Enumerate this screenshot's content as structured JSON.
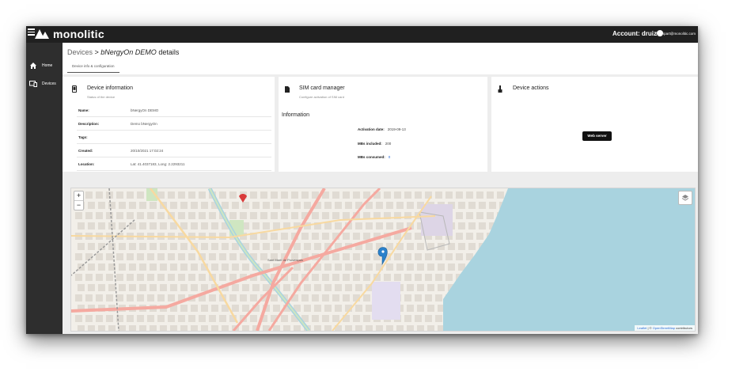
{
  "topbar": {
    "brand": "monolitic",
    "account_label": "Account: druiz",
    "email": "jmonpart@monolitic.com"
  },
  "sidebar": {
    "items": [
      {
        "label": "Home",
        "icon": "home-icon"
      },
      {
        "label": "Devices",
        "icon": "devices-icon"
      }
    ]
  },
  "breadcrumb": {
    "root": "Devices",
    "separator": " > ",
    "device": "bNergyOn DEMO",
    "suffix": " details"
  },
  "tabs": [
    {
      "label": "Device info & configuration",
      "active": true
    }
  ],
  "device_info": {
    "title": "Device information",
    "subtitle": "Status of the device",
    "rows": [
      {
        "key": "Name:",
        "value": "bNergyOn DEMO"
      },
      {
        "key": "Description:",
        "value": "Demo bNergyOn"
      },
      {
        "key": "Tags:",
        "value": ""
      },
      {
        "key": "Created:",
        "value": "20/10/2021 17:02:24"
      },
      {
        "key": "Location:",
        "value": "Lat: 41.4037183, Long: 2.2293211"
      }
    ]
  },
  "sim_card": {
    "title": "SIM card manager",
    "subtitle": "Configure activation of SIM card",
    "section_title": "Information",
    "fields": [
      {
        "key": "Activation date:",
        "value": "2019-09-13"
      },
      {
        "key": "MBs included:",
        "value": "200"
      },
      {
        "key": "MBs consumed:",
        "value": "0"
      }
    ]
  },
  "device_actions": {
    "title": "Device actions",
    "web_server_label": "Web server"
  },
  "map": {
    "zoom_in": "+",
    "zoom_out": "−",
    "attribution_prefix": "Leaflet",
    "attribution_middle": " | © ",
    "attribution_link": "OpenStreetMap",
    "attribution_suffix": " contributors",
    "district_label": "Sant Martí de Provençals",
    "colors": {
      "water": "#a9d3df",
      "land": "#f2efe9",
      "block": "#e0dbd3",
      "major_road": "#f5a9a0",
      "secondary_road": "#f8d9a0",
      "marker": "#2a81cb"
    }
  }
}
